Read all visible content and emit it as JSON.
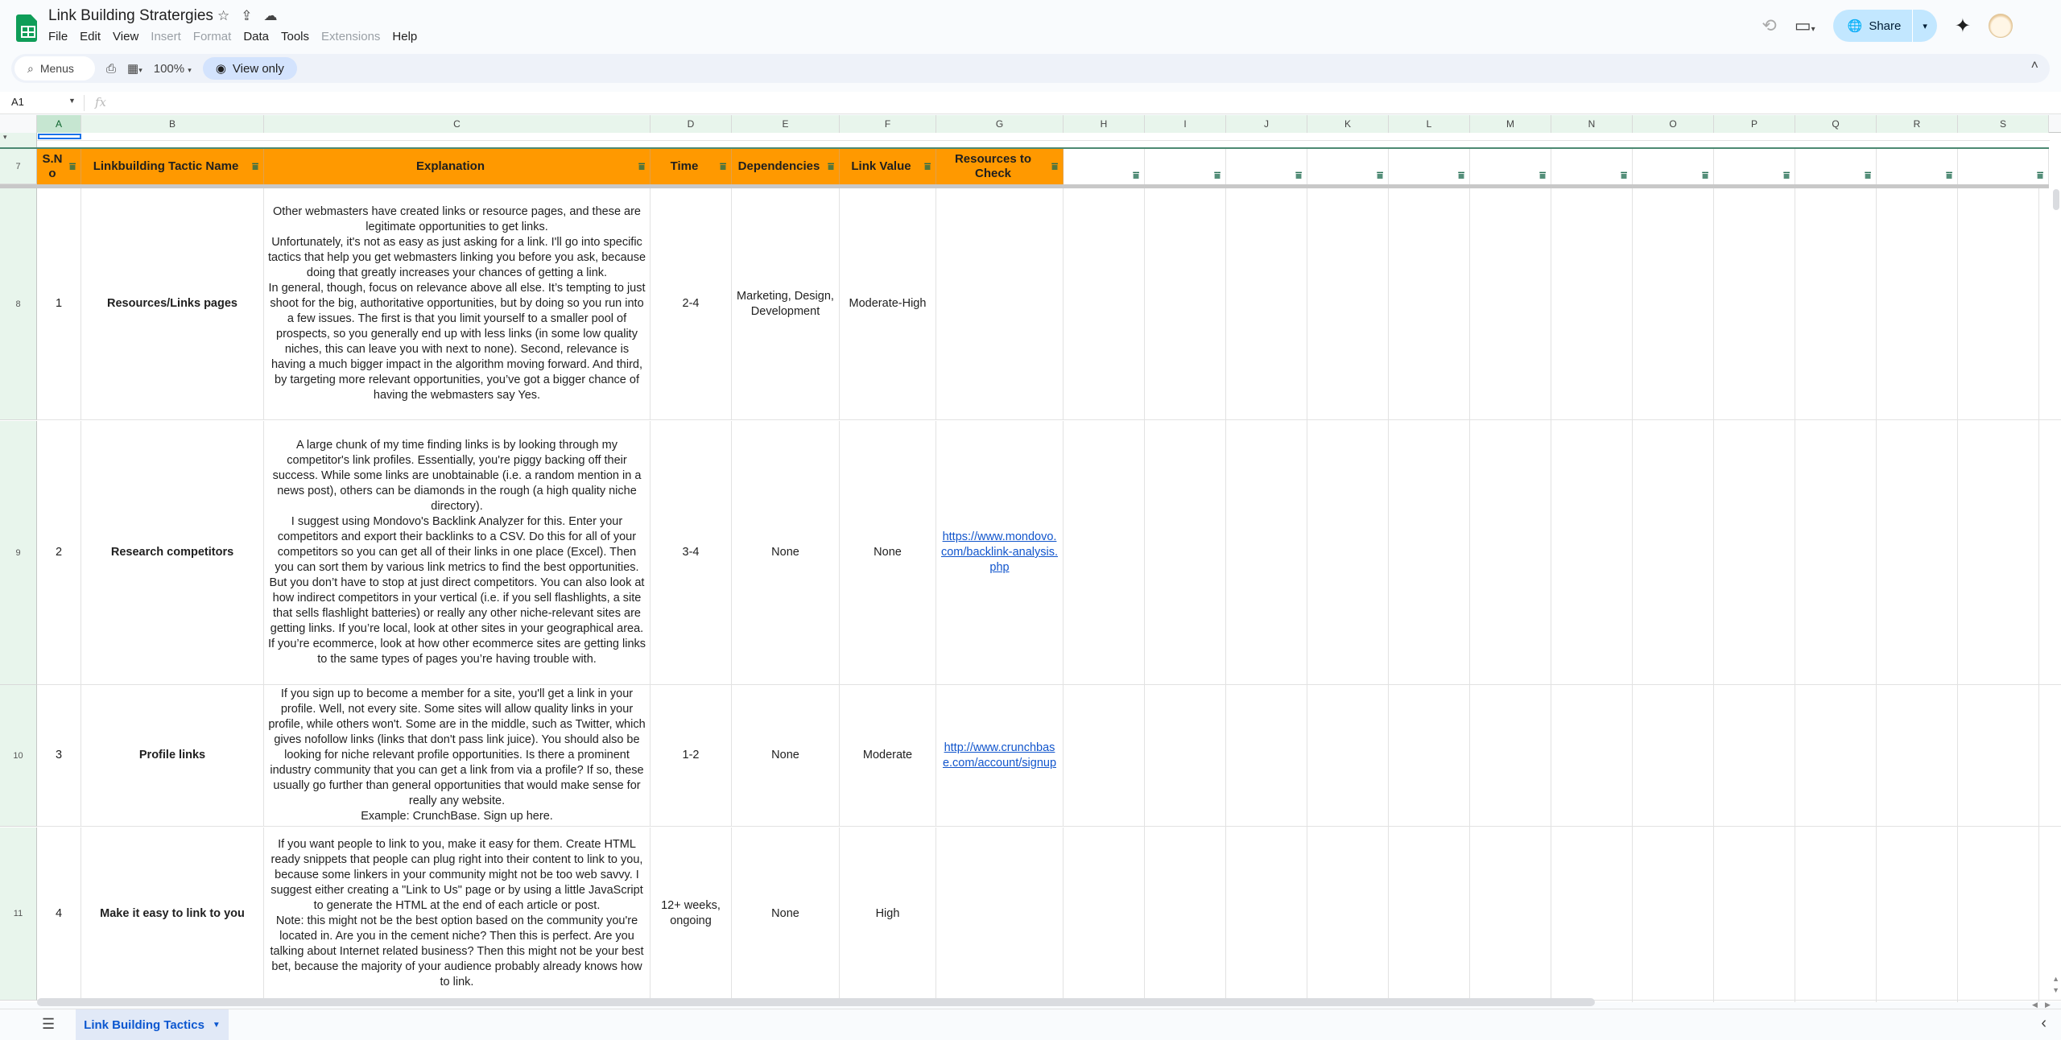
{
  "app": {
    "title": "Link Building Stratergies",
    "icons": {
      "star": "☆",
      "move": "⇪",
      "cloud": "☁"
    },
    "menu": [
      {
        "label": "File",
        "enabled": true
      },
      {
        "label": "Edit",
        "enabled": true
      },
      {
        "label": "View",
        "enabled": true
      },
      {
        "label": "Insert",
        "enabled": false
      },
      {
        "label": "Format",
        "enabled": false
      },
      {
        "label": "Data",
        "enabled": true
      },
      {
        "label": "Tools",
        "enabled": true
      },
      {
        "label": "Extensions",
        "enabled": false
      },
      {
        "label": "Help",
        "enabled": true
      }
    ],
    "share_label": "Share"
  },
  "toolbar": {
    "menus_placeholder": "Menus",
    "zoom": "100%",
    "view_only_label": "View only"
  },
  "formula_bar": {
    "cell_ref": "A1",
    "fx_label": "fx",
    "value": ""
  },
  "grid": {
    "columns": [
      "A",
      "B",
      "C",
      "D",
      "E",
      "F",
      "G",
      "H",
      "I",
      "J",
      "K",
      "L",
      "M",
      "N",
      "O",
      "P",
      "Q",
      "R",
      "S"
    ],
    "active_column": "A",
    "header_row_number": "7",
    "headers": [
      "S.N o",
      "Linkbuilding Tactic Name",
      "Explanation",
      "Time",
      "Dependencies",
      "Link Value",
      "Resources to Check"
    ],
    "rows": [
      {
        "row_number": "8",
        "sno": "1",
        "name": "Resources/Links pages",
        "explanation": "Other webmasters have created links or resource pages, and these are legitimate opportunities to get links.\nUnfortunately, it's not as easy as just asking for a link. I'll go into specific tactics that help you get webmasters linking you before you ask, because doing that greatly increases your chances of getting a link.\nIn general, though, focus on relevance above all else. It’s tempting to just shoot for the big, authoritative opportunities, but by doing so you run into a few issues. The first is that you limit yourself to a smaller pool of prospects, so you generally end up with less links (in some low quality niches, this can leave you with next to none). Second, relevance is having a much bigger impact in the algorithm moving forward. And third, by targeting more relevant opportunities, you’ve got a bigger chance of having the webmasters say Yes.",
        "time": "2-4",
        "dependencies": "Marketing, Design, Development",
        "link_value": "Moderate-High",
        "resource": ""
      },
      {
        "row_number": "9",
        "sno": "2",
        "name": "Research competitors",
        "explanation": "A large chunk of my time finding links is by looking through my competitor's link profiles. Essentially, you're piggy backing off their success. While some links are unobtainable (i.e. a random mention in a news post), others can be diamonds in the rough (a high quality niche directory).\nI suggest using Mondovo's Backlink Analyzer for this. Enter your competitors and export their backlinks to a CSV. Do this for all of your competitors so you can get all of their links in one place (Excel). Then you can sort them by various link metrics to find the best opportunities.\nBut you don’t have to stop at just direct competitors. You can also look at how indirect competitors in your vertical (i.e. if you sell flashlights, a site that sells flashlight batteries) or really any other niche-relevant sites are getting links. If you’re local, look at other sites in your geographical area. If you’re ecommerce, look at how other ecommerce sites are getting links to the same types of pages you’re having trouble with.",
        "time": "3-4",
        "dependencies": "None",
        "link_value": "None",
        "resource": "https://www.mondovo.com/backlink-analysis.php"
      },
      {
        "row_number": "10",
        "sno": "3",
        "name": "Profile links",
        "explanation": "If you sign up to become a member for a site, you'll get a link in your profile. Well, not every site. Some sites will allow quality links in your profile, while others won't. Some are in the middle, such as Twitter, which gives nofollow links (links that don't pass link juice). You should also be looking for niche relevant profile opportunities. Is there a prominent industry community that you can get a link from via a profile? If so, these usually go further than general opportunities that would make sense for really any website.\nExample: CrunchBase. Sign up here.",
        "time": "1-2",
        "dependencies": "None",
        "link_value": "Moderate",
        "resource": "http://www.crunchbase.com/account/signup"
      },
      {
        "row_number": "11",
        "sno": "4",
        "name": "Make it easy to link to you",
        "explanation": "If you want people to link to you, make it easy for them. Create HTML ready snippets that people can plug right into their content to link to you, because some linkers in your community might not be too web savvy. I suggest either creating a \"Link to Us\" page or by using a little JavaScript to generate the HTML at the end of each article or post.\nNote: this might not be the best option based on the community you're located in. Are you in the cement niche? Then this is perfect. Are you talking about Internet related business? Then this might not be your best bet, because the majority of your audience probably already knows how to link.",
        "time": "12+ weeks, ongoing",
        "dependencies": "None",
        "link_value": "High",
        "resource": ""
      }
    ]
  },
  "sheets": {
    "tabs": [
      {
        "label": "Link Building Tactics",
        "active": true
      }
    ]
  },
  "colors": {
    "header_fill": "#ff9900",
    "link": "#1155cc",
    "share_bg": "#c2e7ff",
    "sheets_green": "#0f9d58"
  }
}
